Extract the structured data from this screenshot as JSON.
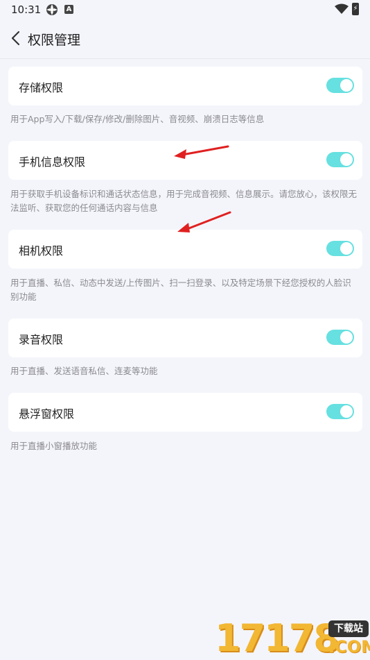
{
  "status_bar": {
    "time": "10:31",
    "icons": [
      "gear-status-icon",
      "a-status-icon",
      "wifi-icon",
      "battery-charging-icon"
    ]
  },
  "header": {
    "title": "权限管理",
    "back_icon": "chevron-left-icon"
  },
  "permissions": [
    {
      "label": "存储权限",
      "enabled": true,
      "desc": "用于App写入/下载/保存/修改/删除图片、音视频、崩溃日志等信息"
    },
    {
      "label": "手机信息权限",
      "enabled": true,
      "desc": "用于获取手机设备标识和通话状态信息，用于完成音视频、信息展示。请您放心，该权限无法监听、获取您的任何通话内容与信息"
    },
    {
      "label": "相机权限",
      "enabled": true,
      "desc": "用于直播、私信、动态中发送/上传图片、扫一扫登录、以及特定场景下经您授权的人脸识别功能"
    },
    {
      "label": "录音权限",
      "enabled": true,
      "desc": "用于直播、发送语音私信、连麦等功能"
    },
    {
      "label": "悬浮窗权限",
      "enabled": true,
      "desc": "用于直播小窗播放功能"
    }
  ],
  "colors": {
    "toggle_on": "#66e0e0",
    "background": "#f4f5fb",
    "annotation_arrow": "#e02020"
  },
  "watermark": {
    "number": "17178",
    "tag": "下载站",
    "suffix": ".COM"
  }
}
